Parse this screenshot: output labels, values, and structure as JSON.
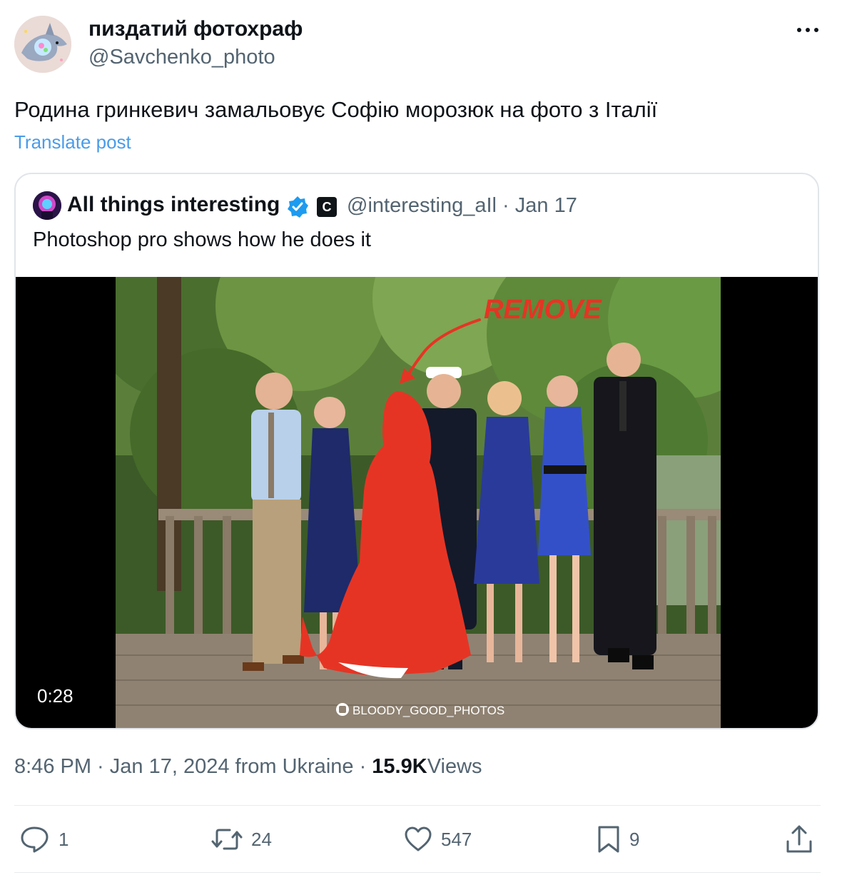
{
  "author": {
    "display_name": "пиздатий фотохраф",
    "handle": "@Savchenko_photo"
  },
  "post": {
    "text": "Родина гринкевич замальовує Софію морозюк на фото з Італії",
    "translate_label": "Translate post"
  },
  "quoted": {
    "display_name": "All things interesting",
    "badge_letter": "C",
    "meta": "@interesting_aIl · Jan 17",
    "text": "Photoshop pro shows how he does it",
    "video": {
      "duration": "0:28",
      "overlay_text": "REMOVE",
      "watermark": "BLOODY_GOOD_PHOTOS"
    }
  },
  "meta": {
    "time_date": "8:46 PM · Jan 17, 2024 from Ukraine · ",
    "views_count": "15.9K",
    "views_label": "Views"
  },
  "actions": {
    "replies": "1",
    "reposts": "24",
    "likes": "547",
    "bookmarks": "9"
  },
  "colors": {
    "accent": "#1d9bf0",
    "link": "#4a9ce8",
    "secondary_text": "#536471",
    "annotation_red": "#e63424"
  }
}
